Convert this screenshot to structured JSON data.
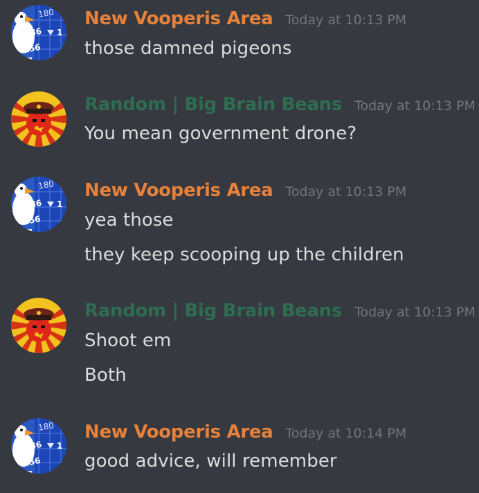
{
  "colors": {
    "background": "#36393f",
    "vooperis_name": "#e6823b",
    "random_name": "#2f6d53",
    "timestamp": "#72767d",
    "text": "#dcddde"
  },
  "messages": [
    {
      "author": "New Vooperis Area",
      "avatar_icon": "goose-stock-ticker-avatar-icon",
      "timestamp": "Today at 10:13 PM",
      "lines": [
        "those damned pigeons"
      ]
    },
    {
      "author": "Random | Big Brain Beans",
      "avatar_icon": "soviet-officer-avatar-icon",
      "timestamp": "Today at 10:13 PM",
      "lines": [
        "You mean government drone?"
      ]
    },
    {
      "author": "New Vooperis Area",
      "avatar_icon": "goose-stock-ticker-avatar-icon",
      "timestamp": "Today at 10:13 PM",
      "lines": [
        "yea those",
        "they keep scooping up the children"
      ]
    },
    {
      "author": "Random | Big Brain Beans",
      "avatar_icon": "soviet-officer-avatar-icon",
      "timestamp": "Today at 10:13 PM",
      "lines": [
        "Shoot em",
        "Both"
      ]
    },
    {
      "author": "New Vooperis Area",
      "avatar_icon": "goose-stock-ticker-avatar-icon",
      "timestamp": "Today at 10:14 PM",
      "lines": [
        "good advice, will remember"
      ]
    }
  ],
  "avatar_ticker": {
    "top_value": "180",
    "mid_value": "286",
    "mid_suffix": "1",
    "bottom_value": "156"
  }
}
